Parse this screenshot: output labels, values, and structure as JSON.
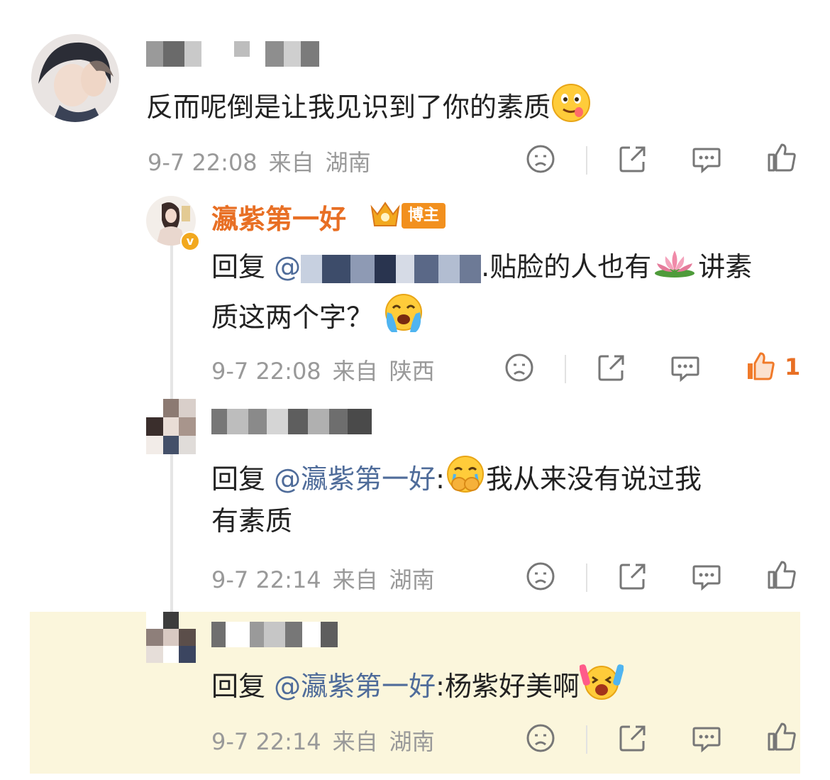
{
  "comments": [
    {
      "text": "反而呢倒是让我见识到了你的素质",
      "emoji": "drooling-face-emoji",
      "time": "9-7 22:08",
      "from": "来自",
      "location": "湖南"
    },
    {
      "username": "瀛紫第一好",
      "badge": "博主",
      "reply_prefix": "回复",
      "mention_prefix": "@",
      "text_line1_after": "贴脸的人也有",
      "lotus": "lotus-emoji",
      "text_line1_end": "讲素",
      "text_line2": "质这两个字？",
      "emoji": "crying-face-emoji",
      "time": "9-7 22:08",
      "from": "来自",
      "location": "陕西",
      "likes": "1"
    },
    {
      "reply_prefix": "回复",
      "mention": "@瀛紫第一好",
      "colon": ":",
      "emoji": "crying-covering-mouth-emoji",
      "text_line1": "我从来没有说过我",
      "text_line2": "有素质",
      "time": "9-7 22:14",
      "from": "来自",
      "location": "湖南"
    },
    {
      "reply_prefix": "回复",
      "mention": "@瀛紫第一好",
      "colon": ":",
      "text": "杨紫好美啊",
      "emoji": "cheering-face-emoji",
      "time": "9-7 22:14",
      "from": "来自",
      "location": "湖南"
    }
  ],
  "colors": {
    "mention": "#4f6c9a",
    "username": "#e86f24",
    "meta": "#999999",
    "highlight": "#fbf6dc"
  }
}
